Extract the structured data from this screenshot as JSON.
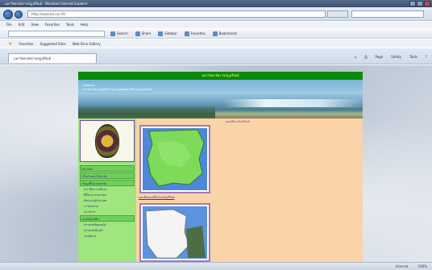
{
  "window": {
    "title": "มหาวิทยาลัยราชภัฏบุรีรัมย์ - Windows Internet Explorer"
  },
  "address": {
    "url": "http://www.bru.ac.th/"
  },
  "menu": {
    "items": [
      "File",
      "Edit",
      "View",
      "Favorites",
      "Tools",
      "Help"
    ]
  },
  "toolbar": {
    "items": [
      "Search",
      "Share",
      "Sidebar",
      "Favorites",
      "Bookmarks"
    ]
  },
  "favorites": {
    "label": "Favorites",
    "links": [
      "Suggested Sites",
      "Web Slice Gallery"
    ]
  },
  "tab": {
    "title": "มหาวิทยาลัยราชภัฏบุรีรัมย์"
  },
  "commandbar": {
    "items": [
      "Page",
      "Safety",
      "Tools"
    ]
  },
  "site": {
    "header": "มหาวิทยาลัยราชภัฏบุรีรัมย์",
    "banner_text": [
      "ยินดีต้อนรับ",
      "มหาวิทยาลัยราชภัฏบุรีรัมย์ สถาบันอุดมศึกษาเพื่อการพัฒนาท้องถิ่น"
    ],
    "nav_sections": [
      {
        "title": "หน้าหลัก",
        "items": []
      },
      {
        "title": "เกี่ยวกับมหาวิทยาลัย",
        "items": []
      },
      {
        "title": "ข้อมูลพื้นฐานจังหวัด",
        "items": [
          "ประวัติความเป็นมา",
          "ที่ตั้งและอาณาเขต",
          "ลักษณะภูมิประเทศ",
          "การปกครอง",
          "ประชากร"
        ]
      },
      {
        "title": "แหล่งท่องเที่ยว",
        "items": [
          "ปราสาทหินพนมรุ้ง",
          "ปราสาทเมืองต่ำ",
          "วนอุทยาน"
        ]
      }
    ],
    "main_caption": "แผนที่จังหวัดบุรีรัมย์",
    "map_label": "แผนที่แสดงที่ตั้งจังหวัดบุรีรัมย์"
  },
  "status": {
    "zone": "Internet",
    "zoom": "100%"
  }
}
